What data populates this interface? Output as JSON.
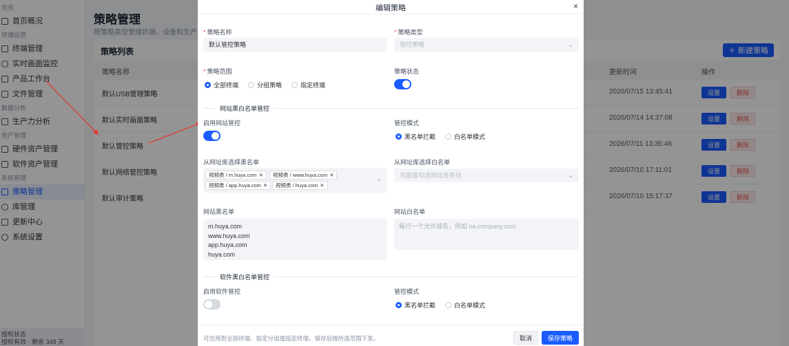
{
  "sidebar": {
    "groups": {
      "g1": "总览",
      "g2": "终端运营",
      "g3": "数据分析",
      "g4": "资产管理",
      "g5": "系统管理"
    },
    "items": {
      "home": "首页概况",
      "terminal": "终端管理",
      "monitor": "实时画面监控",
      "workbench": "产品工作台",
      "files": "文件管理",
      "productivity": "生产力分析",
      "hardware": "硬件资产管理",
      "software": "软件资产管理",
      "policy": "策略管理",
      "library": "库管理",
      "updates": "更新中心",
      "settings": "系统设置"
    },
    "footer": {
      "line1": "授权状态",
      "line2": "授权有效 · 剩余 348 天"
    }
  },
  "page": {
    "title": "策略管理",
    "subtitle": "按策略类型管理终端、设备和生产力分析"
  },
  "list": {
    "title": "策略列表",
    "new_button": "＋ 新建策略",
    "headers": {
      "name": "策略名称",
      "updated": "更新时间",
      "actions": "操作"
    },
    "rows": [
      {
        "name": "默认USB管理策略",
        "updated": "2026/07/15 13:45:41"
      },
      {
        "name": "默认实时画面策略",
        "updated": "2026/07/14 14:37:08"
      },
      {
        "name": "默认管控策略",
        "updated": "2026/07/11 13:35:46"
      },
      {
        "name": "默认网络管控策略",
        "updated": "2026/07/10 17:11:01"
      },
      {
        "name": "默认审计策略",
        "updated": "2026/07/10 15:17:37"
      }
    ],
    "set_label": "设置",
    "delete_label": "删除"
  },
  "modal": {
    "title": "编辑策略",
    "close": "×",
    "name_label": "策略名称",
    "name_value": "默认管控策略",
    "type_label": "策略类型",
    "type_value": "管控策略",
    "scope_label": "策略范围",
    "scope_options": {
      "all": "全部终端",
      "group": "分组策略",
      "specific": "指定终端"
    },
    "scope_selected": "全部终端",
    "status_label": "策略状态",
    "status_on": true,
    "web_section": "网站黑白名单管控",
    "web_enable_label": "启用网站管控",
    "web_enabled": true,
    "web_mode_label": "管控模式",
    "web_mode_options": {
      "black": "黑名单拦截",
      "white": "白名单模式"
    },
    "web_mode_selected": "黑名单拦截",
    "black_lib_label": "从网址库选择黑名单",
    "black_lib_tags": [
      "视频类 / m.huya.com",
      "视频类 / www.huya.com",
      "视频类 / app.huya.com",
      "视频类 / huya.com"
    ],
    "white_lib_label": "从网址库选择白名单",
    "white_lib_placeholder": "可直接勾选网址库条目",
    "blacklist_label": "网站黑名单",
    "blacklist_lines": [
      "m.huya.com",
      "www.huya.com",
      "app.huya.com",
      "huya.com"
    ],
    "whitelist_label": "网站白名单",
    "whitelist_placeholder": "每行一个允许域名，例如 oa.company.com",
    "soft_section": "软件黑白名单管控",
    "soft_enable_label": "启用软件管控",
    "soft_enabled": false,
    "soft_mode_label": "管控模式",
    "soft_mode_options": {
      "black": "黑名单拦截",
      "white": "白名单模式"
    },
    "soft_mode_selected": "黑名单拦截",
    "footer_note": "可应用到全部终端、指定分组或指定终端，保存后按所选范围下发。",
    "cancel": "取消",
    "save": "保存策略"
  },
  "colors": {
    "primary": "#1a5cff",
    "danger": "#e45656",
    "required": "#e54848",
    "annotation_arrow": "#e53935"
  },
  "icons": {
    "close": "close-icon",
    "chevron": "chevron-down-icon",
    "tag_remove": "tag-remove-icon"
  }
}
